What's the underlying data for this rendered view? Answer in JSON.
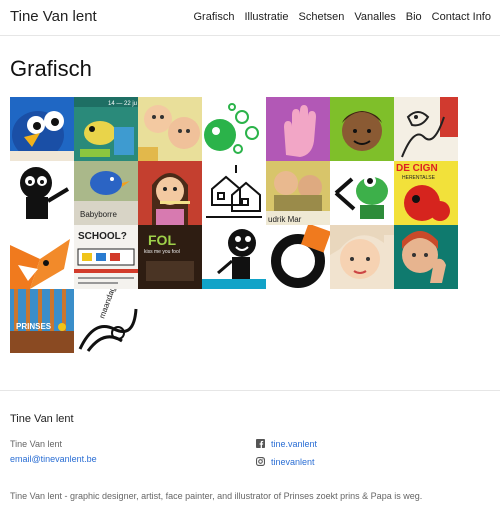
{
  "site": {
    "brand": "Tine Van lent"
  },
  "nav": {
    "items": [
      "Grafisch",
      "Illustratie",
      "Schetsen",
      "Vanalles",
      "Bio",
      "Contact Info"
    ]
  },
  "page": {
    "title": "Grafisch"
  },
  "gallery": {
    "tiles": [
      {
        "name": "blue-bird-illustration"
      },
      {
        "name": "poster-14-juni"
      },
      {
        "name": "baby-faces"
      },
      {
        "name": "green-bubbles"
      },
      {
        "name": "pink-hand"
      },
      {
        "name": "boy-face-green"
      },
      {
        "name": "sketch-red"
      },
      {
        "name": "black-creature"
      },
      {
        "name": "babyborre-bird",
        "text": "Babyborre"
      },
      {
        "name": "girl-flute"
      },
      {
        "name": "house-drawing"
      },
      {
        "name": "children-yellow",
        "text": "udrik Mar"
      },
      {
        "name": "green-frog"
      },
      {
        "name": "poster-red-yellow",
        "text": "DE CIGN",
        "subtext": "HERENTALSE"
      },
      {
        "name": "orange-fox"
      },
      {
        "name": "school-poster",
        "text": "SCHOOL?"
      },
      {
        "name": "fol-dark",
        "text": "FOL",
        "subtext": "kiss me you fool"
      },
      {
        "name": "black-figure"
      },
      {
        "name": "orange-circle"
      },
      {
        "name": "girl-face"
      },
      {
        "name": "girl-teal"
      },
      {
        "name": "prinses-poster",
        "text": "PRINSES"
      },
      {
        "name": "maandag-sketch",
        "text": "maandag"
      }
    ]
  },
  "footer": {
    "title": "Tine Van lent",
    "name": "Tine Van lent",
    "email": "email@tinevanlent.be",
    "facebook": "tine.vanlent",
    "instagram": "tinevanlent",
    "tagline": "Tine Van lent - graphic designer, artist, face painter, and illustrator of Prinses zoekt prins & Papa is weg."
  },
  "colors": {
    "link": "#2a6ed4",
    "text": "#222222",
    "muted": "#666666",
    "border": "#e6e6e6"
  }
}
